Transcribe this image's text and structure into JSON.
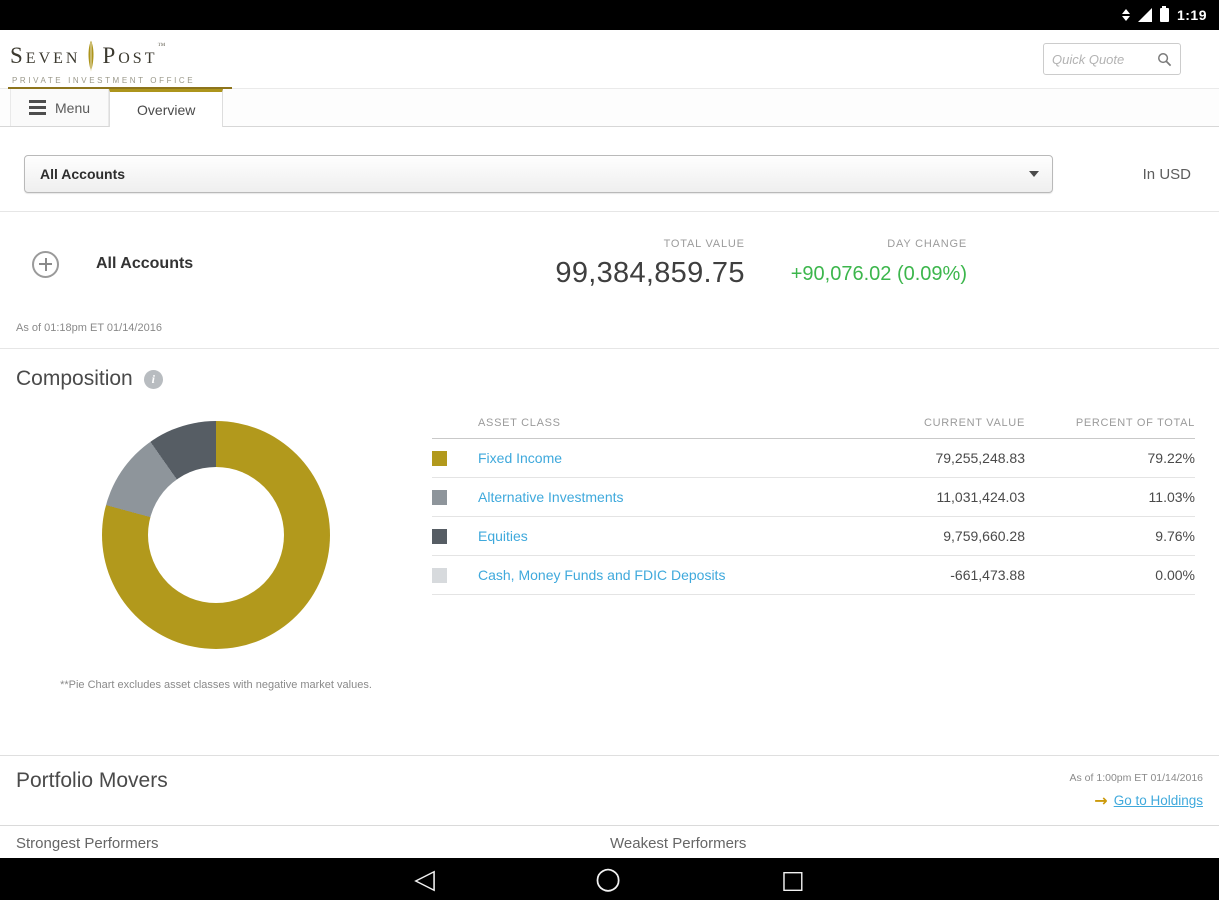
{
  "colors": {
    "brand_gold": "#ad951c",
    "link_blue": "#3fa9dc",
    "positive_green": "#3cb64c"
  },
  "status_bar": {
    "time": "1:19"
  },
  "header": {
    "brand_first": "Seven",
    "brand_second": "Post",
    "brand_tm": "™",
    "tagline": "PRIVATE INVESTMENT OFFICE",
    "quick_quote_placeholder": "Quick Quote"
  },
  "tab_bar": {
    "menu": "Menu",
    "overview": "Overview"
  },
  "account_selector": {
    "selected": "All Accounts",
    "currency": "In USD"
  },
  "summary": {
    "account_name": "All Accounts",
    "total_value_label": "TOTAL VALUE",
    "total_value": "99,384,859.75",
    "day_change_label": "DAY CHANGE",
    "day_change": "+90,076.02 (0.09%)",
    "as_of": "As of 01:18pm ET 01/14/2016"
  },
  "composition": {
    "title": "Composition",
    "footnote": "**Pie Chart excludes asset classes with negative market values.",
    "headers": {
      "asset_class": "ASSET CLASS",
      "current_value": "CURRENT VALUE",
      "percent_of_total": "PERCENT OF TOTAL"
    },
    "rows": [
      {
        "label": "Fixed Income",
        "value": "79,255,248.83",
        "percent": "79.22%",
        "color": "#b2991c"
      },
      {
        "label": "Alternative Investments",
        "value": "11,031,424.03",
        "percent": "11.03%",
        "color": "#8e959b"
      },
      {
        "label": "Equities",
        "value": "9,759,660.28",
        "percent": "9.76%",
        "color": "#565d64"
      },
      {
        "label": "Cash, Money Funds and FDIC Deposits",
        "value": "-661,473.88",
        "percent": "0.00%",
        "color": "#d7dadd"
      }
    ]
  },
  "chart_data": {
    "type": "pie",
    "title": "Composition",
    "donut": true,
    "labels": [
      "Fixed Income",
      "Alternative Investments",
      "Equities"
    ],
    "values": [
      79.22,
      11.03,
      9.76
    ],
    "colors": [
      "#b2991c",
      "#8e959b",
      "#565d64"
    ],
    "note": "Cash, Money Funds and FDIC Deposits (-661,473.88) excluded from pie due to negative market value"
  },
  "portfolio_movers": {
    "title": "Portfolio Movers",
    "as_of": "As of 1:00pm ET 01/14/2016",
    "go_to_holdings": "Go to Holdings",
    "strongest": "Strongest Performers",
    "weakest": "Weakest Performers"
  },
  "nav_bar": {
    "back": "◁",
    "home": "○",
    "recents": "□"
  }
}
